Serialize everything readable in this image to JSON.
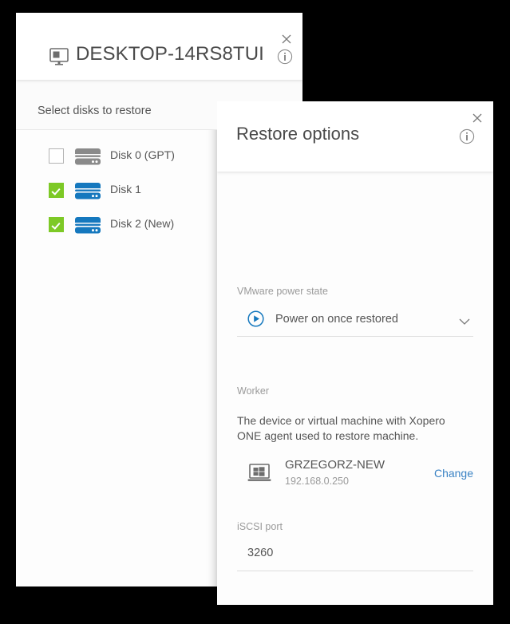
{
  "left_panel": {
    "title": "DESKTOP-14RS8TUI",
    "device_icon": "monitor-icon",
    "info_icon": "info-icon",
    "close_icon": "close-icon",
    "section_label": "Select disks to restore",
    "disks": [
      {
        "label": "Disk 0 (GPT)",
        "checked": false,
        "icon": "disk-icon",
        "icon_color": "#8a8a8a"
      },
      {
        "label": "Disk 1",
        "checked": true,
        "icon": "disk-icon",
        "icon_color": "#1578be"
      },
      {
        "label": "Disk 2 (New)",
        "checked": true,
        "icon": "disk-icon",
        "icon_color": "#1578be"
      }
    ]
  },
  "right_panel": {
    "title": "Restore options",
    "info_icon": "info-icon",
    "close_icon": "close-icon",
    "power_state": {
      "label": "VMware power state",
      "value": "Power on once restored",
      "icon": "play-circle-icon",
      "chevron": "chevron-down-icon"
    },
    "worker": {
      "label": "Worker",
      "description": "The device or virtual machine with Xopero ONE agent used to restore machine.",
      "device_name": "GRZEGORZ-NEW",
      "device_ip": "192.168.0.250",
      "device_icon": "windows-laptop-icon",
      "change_label": "Change"
    },
    "iscsi": {
      "label": "iSCSI port",
      "value": "3260"
    }
  },
  "colors": {
    "accent_blue": "#1578be",
    "link_blue": "#3a82c4",
    "check_green": "#7dc926",
    "disk_gray": "#8a8a8a",
    "text_primary": "#555555",
    "text_muted": "#9a9a9a"
  }
}
